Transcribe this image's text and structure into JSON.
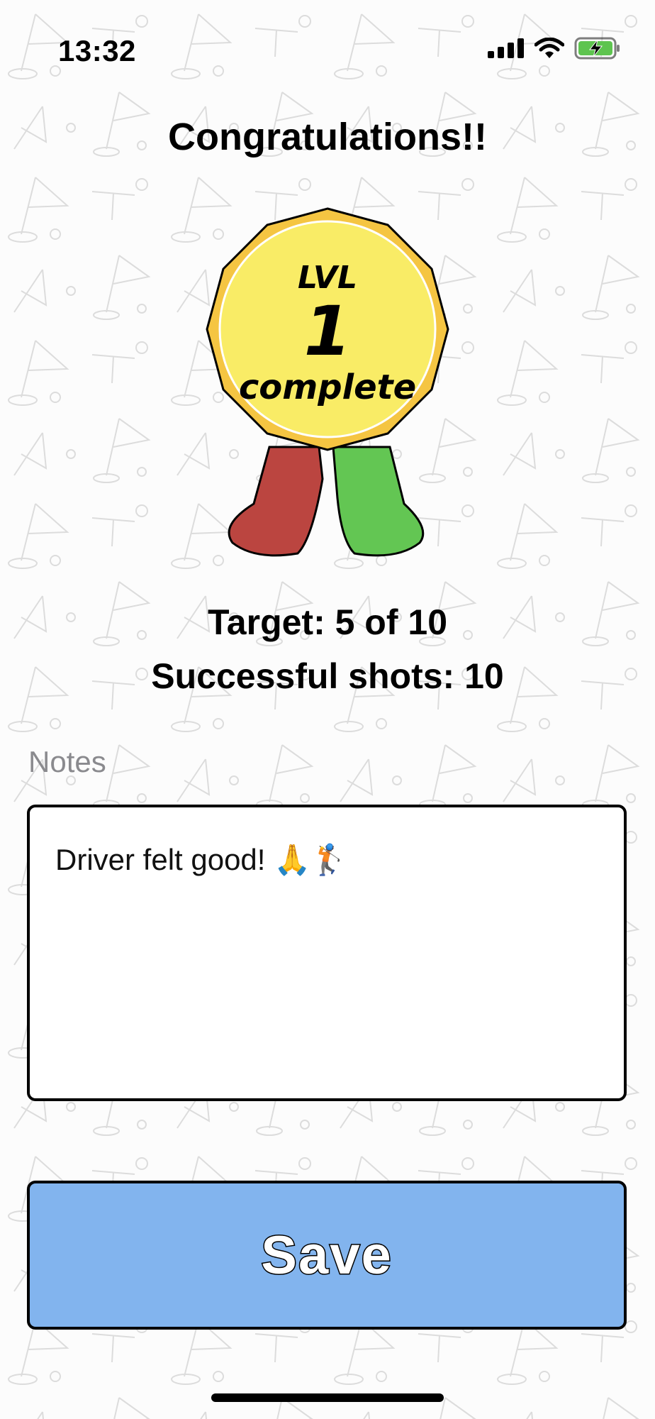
{
  "status_bar": {
    "time": "13:32",
    "icons": [
      "signal-icon",
      "wifi-icon",
      "battery-charging-icon"
    ],
    "battery_color": "#5ec44f"
  },
  "title": "Congratulations!!",
  "badge": {
    "line1": "LVL",
    "line2": "1",
    "line3": "complete",
    "colors": {
      "outer": "#f5c542",
      "inner": "#f9ec66",
      "ribbon_left": "#bb4540",
      "ribbon_right": "#63c653"
    }
  },
  "stats": {
    "target": "Target: 5 of 10",
    "shots": "Successful shots: 10"
  },
  "notes": {
    "label": "Notes",
    "value": "Driver felt good! 🙏🏌️"
  },
  "save_button": {
    "label": "Save",
    "color": "#82b4ee"
  }
}
